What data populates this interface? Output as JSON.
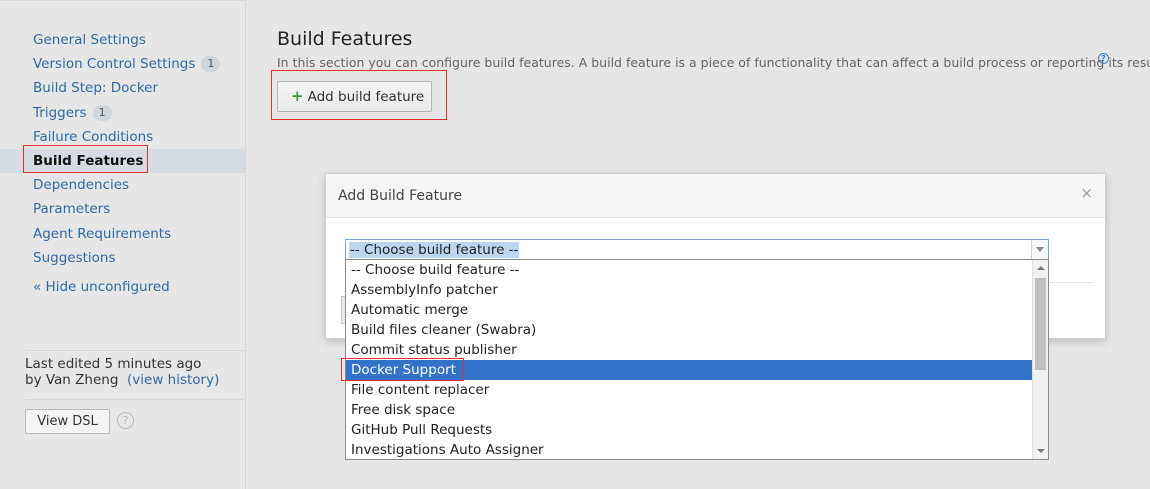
{
  "sidebar": {
    "items": [
      {
        "label": "General Settings",
        "badge": null
      },
      {
        "label": "Version Control Settings",
        "badge": "1"
      },
      {
        "label": "Build Step: Docker",
        "badge": null
      },
      {
        "label": "Triggers",
        "badge": "1"
      },
      {
        "label": "Failure Conditions",
        "badge": null
      },
      {
        "label": "Build Features",
        "badge": null,
        "active": true
      },
      {
        "label": "Dependencies",
        "badge": null
      },
      {
        "label": "Parameters",
        "badge": null
      },
      {
        "label": "Agent Requirements",
        "badge": null
      },
      {
        "label": "Suggestions",
        "badge": null
      }
    ],
    "hide_unconfigured": "« Hide unconfigured",
    "last_edited_prefix": "Last edited",
    "last_edited_time": "5 minutes ago",
    "last_edited_by": "by Van Zheng",
    "view_history": "(view history)",
    "view_dsl": "View DSL",
    "help_glyph": "?"
  },
  "main": {
    "title": "Build Features",
    "description": "In this section you can configure build features. A build feature is a piece of functionality that can affect a build process or reporting its results.",
    "add_button": "Add build feature",
    "plus_glyph": "+",
    "info_glyph": "?"
  },
  "dialog": {
    "title": "Add Build Feature",
    "close_glyph": "×",
    "select_value": "-- Choose build feature --",
    "options": [
      "-- Choose build feature --",
      "AssemblyInfo patcher",
      "Automatic merge",
      "Build files cleaner (Swabra)",
      "Commit status publisher",
      "Docker Support",
      "File content replacer",
      "Free disk space",
      "GitHub Pull Requests",
      "Investigations Auto Assigner"
    ],
    "selected_option": "Docker Support"
  },
  "colors": {
    "link": "#2f6aa8",
    "selection": "#3073c8",
    "highlight_box": "#e03030",
    "plus_green": "#3c9a3c"
  }
}
